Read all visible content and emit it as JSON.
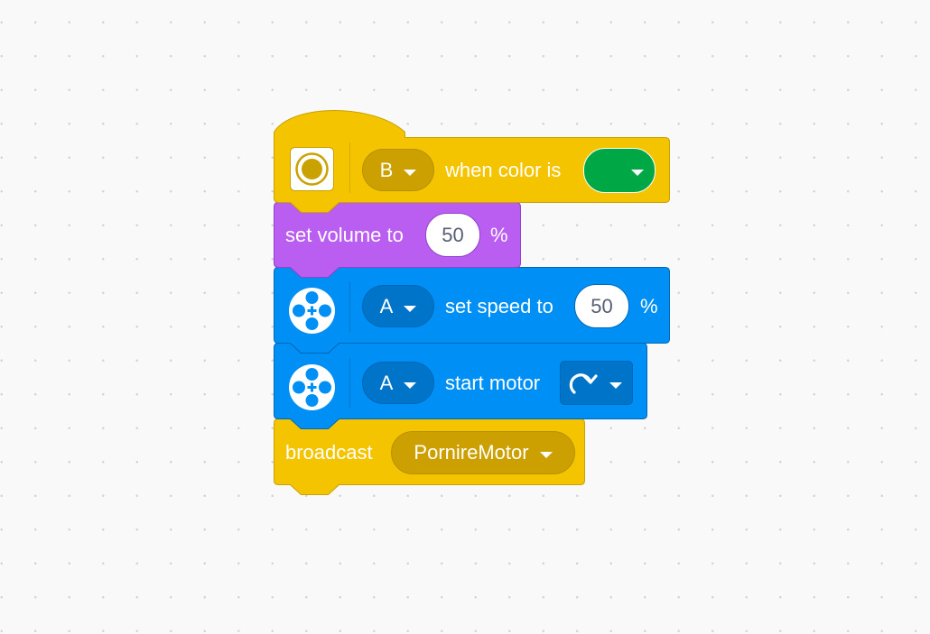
{
  "colors": {
    "event": "#f5c400",
    "event_dark": "#cca000",
    "event_border": "#c9a200",
    "sound": "#b95ef0",
    "sound_border": "#9042c9",
    "motor": "#0090f5",
    "motor_dark": "#0074c8",
    "motor_border": "#0068b8",
    "color_green": "#00a845"
  },
  "blocks": {
    "hat": {
      "icon": "color-sensor-icon",
      "port": "B",
      "label": "when color is",
      "color_value": "green"
    },
    "volume": {
      "label": "set volume to",
      "value": "50",
      "unit": "%"
    },
    "speed": {
      "icon": "motor-icon",
      "port": "A",
      "label": "set speed to",
      "value": "50",
      "unit": "%"
    },
    "start": {
      "icon": "motor-icon",
      "port": "A",
      "label": "start motor",
      "direction_icon": "clockwise-arrow-icon"
    },
    "broadcast": {
      "label": "broadcast",
      "message": "PornireMotor"
    }
  }
}
